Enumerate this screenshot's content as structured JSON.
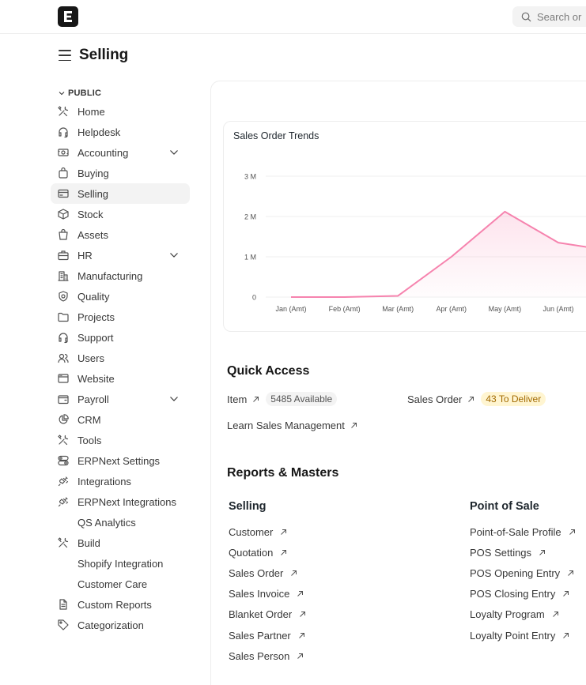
{
  "navbar": {
    "logo_icon": "erpnext-logo-icon",
    "search_placeholder": "Search or"
  },
  "page": {
    "title": "Selling"
  },
  "sidebar": {
    "section": "PUBLIC",
    "items": [
      {
        "label": "Home",
        "icon": "tools-icon",
        "expandable": false,
        "active": false
      },
      {
        "label": "Helpdesk",
        "icon": "headset-icon",
        "expandable": false,
        "active": false
      },
      {
        "label": "Accounting",
        "icon": "cash-icon",
        "expandable": true,
        "active": false
      },
      {
        "label": "Buying",
        "icon": "bag-icon",
        "expandable": false,
        "active": false
      },
      {
        "label": "Selling",
        "icon": "card-icon",
        "expandable": false,
        "active": true
      },
      {
        "label": "Stock",
        "icon": "box-icon",
        "expandable": false,
        "active": false
      },
      {
        "label": "Assets",
        "icon": "basket-icon",
        "expandable": false,
        "active": false
      },
      {
        "label": "HR",
        "icon": "briefcase-icon",
        "expandable": true,
        "active": false
      },
      {
        "label": "Manufacturing",
        "icon": "building-icon",
        "expandable": false,
        "active": false
      },
      {
        "label": "Quality",
        "icon": "badge-icon",
        "expandable": false,
        "active": false
      },
      {
        "label": "Projects",
        "icon": "folder-icon",
        "expandable": false,
        "active": false
      },
      {
        "label": "Support",
        "icon": "headset-icon",
        "expandable": false,
        "active": false
      },
      {
        "label": "Users",
        "icon": "users-icon",
        "expandable": false,
        "active": false
      },
      {
        "label": "Website",
        "icon": "browser-icon",
        "expandable": false,
        "active": false
      },
      {
        "label": "Payroll",
        "icon": "wallet-icon",
        "expandable": true,
        "active": false
      },
      {
        "label": "CRM",
        "icon": "pie-chart-icon",
        "expandable": false,
        "active": false
      },
      {
        "label": "Tools",
        "icon": "tools-icon",
        "expandable": false,
        "active": false
      },
      {
        "label": "ERPNext Settings",
        "icon": "toggles-icon",
        "expandable": false,
        "active": false
      },
      {
        "label": "Integrations",
        "icon": "plug-icon",
        "expandable": false,
        "active": false
      },
      {
        "label": "ERPNext Integrations",
        "icon": "plug-icon",
        "expandable": false,
        "active": false
      },
      {
        "label": "QS Analytics",
        "icon": "",
        "expandable": false,
        "active": false
      },
      {
        "label": "Build",
        "icon": "tools-icon",
        "expandable": false,
        "active": false
      },
      {
        "label": "Shopify Integration",
        "icon": "",
        "expandable": false,
        "active": false
      },
      {
        "label": "Customer Care",
        "icon": "",
        "expandable": false,
        "active": false
      },
      {
        "label": "Custom Reports",
        "icon": "file-icon",
        "expandable": false,
        "active": false
      },
      {
        "label": "Categorization",
        "icon": "tag-icon",
        "expandable": false,
        "active": false
      }
    ]
  },
  "chart": {
    "title": "Sales Order Trends",
    "line_color": "#f683ae"
  },
  "chart_data": {
    "type": "area",
    "title": "Sales Order Trends",
    "categories": [
      "Jan (Amt)",
      "Feb (Amt)",
      "Mar (Amt)",
      "Apr (Amt)",
      "May (Amt)",
      "Jun (Amt)"
    ],
    "series": [
      {
        "values": [
          0,
          0,
          30000,
          1000000,
          2120000,
          1350000
        ]
      }
    ],
    "y_ticks": [
      "0",
      "1 M",
      "2 M",
      "3 M"
    ],
    "ylim": [
      0,
      3000000
    ],
    "grid": true
  },
  "quick_access": {
    "heading": "Quick Access",
    "links": [
      {
        "label": "Item",
        "badge": "5485 Available",
        "badge_color": "grey"
      },
      {
        "label": "Sales Order",
        "badge": "43 To Deliver",
        "badge_color": "yellow"
      },
      {
        "label": "Learn Sales Management",
        "badge": "",
        "badge_color": ""
      }
    ]
  },
  "reports": {
    "heading": "Reports & Masters",
    "columns": [
      {
        "title": "Selling",
        "links": [
          "Customer",
          "Quotation",
          "Sales Order",
          "Sales Invoice",
          "Blanket Order",
          "Sales Partner",
          "Sales Person"
        ]
      },
      {
        "title": "Point of Sale",
        "links": [
          "Point-of-Sale Profile",
          "POS Settings",
          "POS Opening Entry",
          "POS Closing Entry",
          "Loyalty Program",
          "Loyalty Point Entry"
        ]
      }
    ]
  }
}
